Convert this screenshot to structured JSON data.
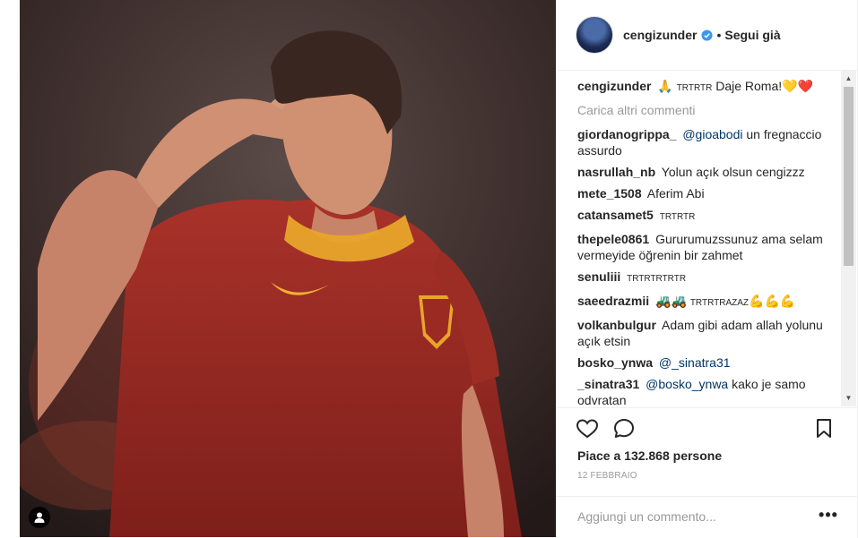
{
  "post": {
    "username": "cengizunder",
    "follow_label": "Segui già",
    "separator": "•"
  },
  "caption": {
    "username": "cengizunder",
    "emoji": "🙏",
    "flags": "TRTRTR",
    "text": "Daje Roma!",
    "hearts": "💛❤️"
  },
  "load_more_label": "Carica altri commenti",
  "comments": [
    {
      "username": "giordanogrippa_",
      "mention": "@gioabodi",
      "text": "un fregnaccio assurdo"
    },
    {
      "username": "nasrullah_nb",
      "text": "Yolun açık olsun cengizzz"
    },
    {
      "username": "mete_1508",
      "text": "Aferim Abi"
    },
    {
      "username": "catansamet5",
      "small": "TRTRTR"
    },
    {
      "username": "thepele0861",
      "text": "Gururumuzssunuz ama selam vermeyide öğrenin bir zahmet"
    },
    {
      "username": "senuliii",
      "small": "TRTRTRTRTR"
    },
    {
      "username": "saeedrazmii",
      "emoji": "🚜🚜",
      "small": "TRTRTRAZAZ",
      "emoji2": "💪💪💪"
    },
    {
      "username": "volkanbulgur",
      "text": "Adam gibi adam allah yolunu açık etsin"
    },
    {
      "username": "bosko_ynwa",
      "mention": "@_sinatra31"
    },
    {
      "username": "_sinatra31",
      "mention": "@bosko_ynwa",
      "text": "kako je samo odvratan"
    }
  ],
  "likes": "Piace a 132.868 persone",
  "date": "12 FEBBRAIO",
  "add_comment_placeholder": "Aggiungi un commento...",
  "more_label": "•••",
  "scroll_up": "▲",
  "scroll_down": "▼",
  "icons": {
    "like": "heart-icon",
    "comment": "comment-bubble-icon",
    "save": "bookmark-icon",
    "tagged": "user-tag-icon",
    "verified": "verified-badge-icon"
  },
  "colors": {
    "verified": "#3897f0",
    "muted": "#999999",
    "mention": "#003569",
    "text": "#262626"
  }
}
